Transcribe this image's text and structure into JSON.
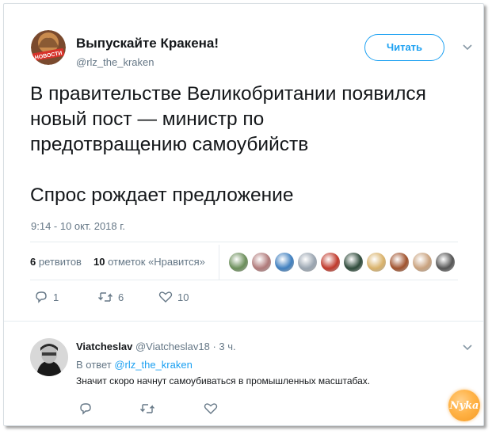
{
  "tweet": {
    "author_name": "Выпускайте Кракена!",
    "author_handle": "@rlz_the_kraken",
    "avatar_badge": "НОВОСТИ",
    "follow_label": "Читать",
    "text_lines": [
      "В правительстве Великобритании появился",
      "новый пост — министр по",
      "предотвращению самоубийств"
    ],
    "text_tail": "Спрос рождает предложение",
    "timestamp": "9:14 - 10 окт. 2018 г.",
    "retweets_count": "6",
    "retweets_label": "ретвитов",
    "likes_count": "10",
    "likes_label": "отметок «Нравится»",
    "liker_avatars": [
      "#6b8e5a",
      "#b07a7a",
      "#3f7fbf",
      "#9aa5b1",
      "#c0392b",
      "#2e4a3a",
      "#d9b26a",
      "#a0522d",
      "#c9a27e",
      "#555555"
    ],
    "actions": {
      "reply_count": "1",
      "retweet_count": "6",
      "like_count": "10"
    }
  },
  "reply": {
    "author_name": "Viatcheslav",
    "author_handle": "@Viatcheslav18",
    "time": "· 3 ч.",
    "reply_to_prefix": "В ответ",
    "reply_to_handle": "@rlz_the_kraken",
    "text": "Значит скоро начнут самоубиваться в промышленных масштабах."
  },
  "watermark": {
    "text": "Nyka"
  },
  "colors": {
    "accent": "#1da1f2",
    "muted": "#657786",
    "text": "#14171a",
    "divider": "#e6ecf0"
  }
}
